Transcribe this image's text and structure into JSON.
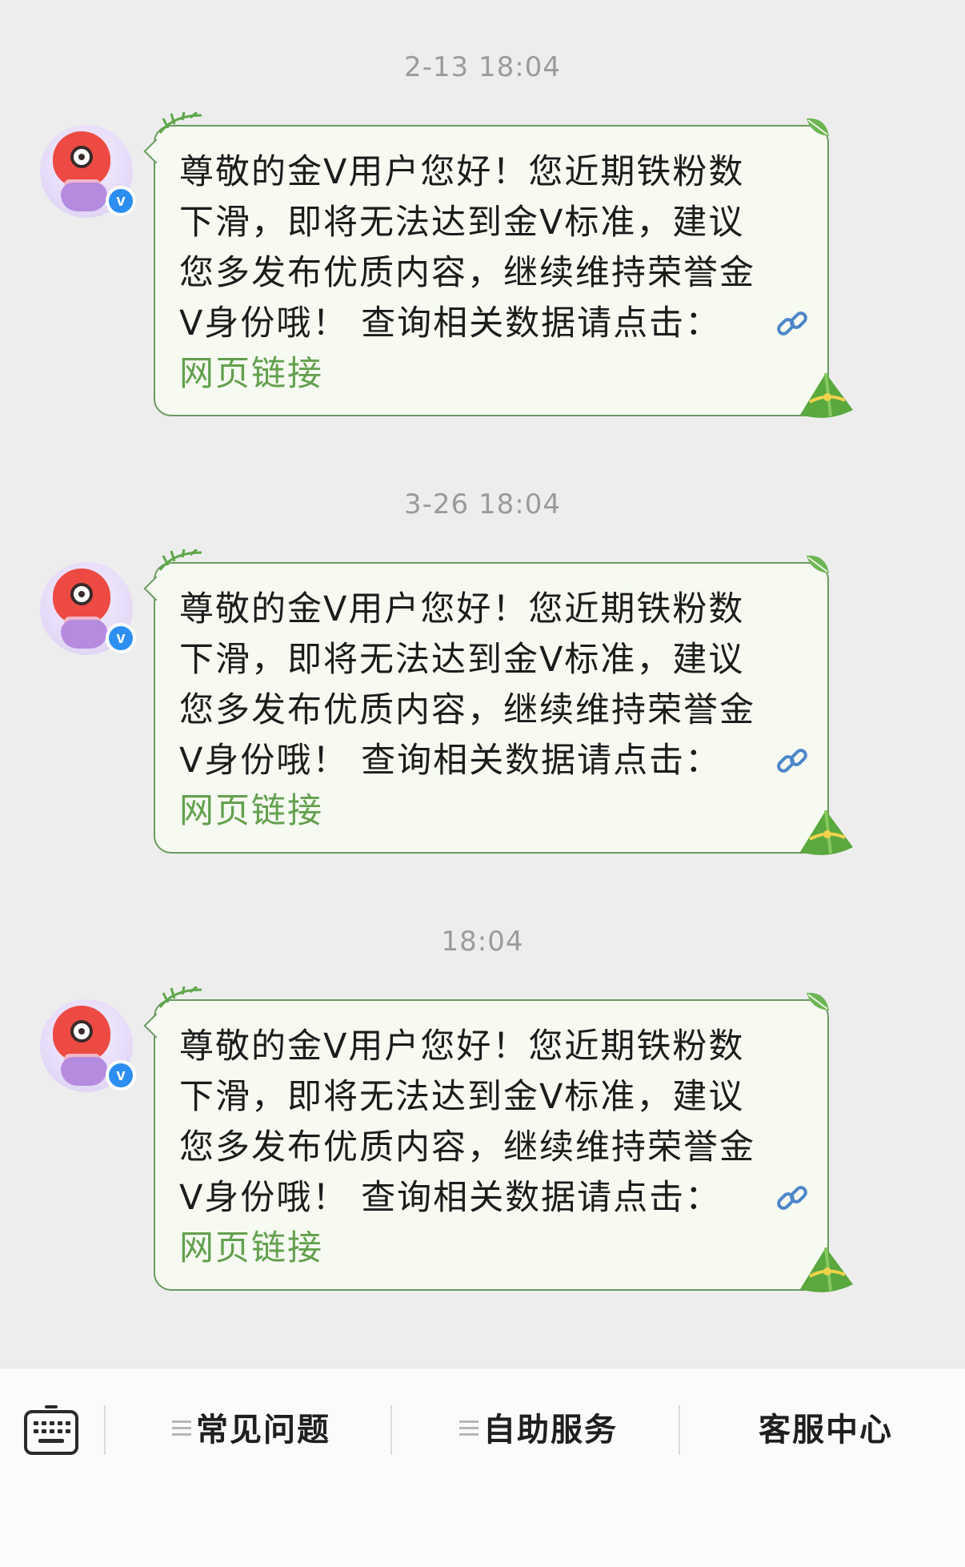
{
  "messages": [
    {
      "timestamp": "2-13 18:04",
      "lines": [
        "尊敬的金V用户您好！您近期铁粉数",
        "下滑，即将无法达到金V标准，建议",
        "您多发布优质内容，继续维持荣誉金",
        "V身份哦！ 查询相关数据请点击："
      ],
      "link_text": "网页链接",
      "verified_mark": "v"
    },
    {
      "timestamp": "3-26 18:04",
      "lines": [
        "尊敬的金V用户您好！您近期铁粉数",
        "下滑，即将无法达到金V标准，建议",
        "您多发布优质内容，继续维持荣誉金",
        "V身份哦！ 查询相关数据请点击："
      ],
      "link_text": "网页链接",
      "verified_mark": "v"
    },
    {
      "timestamp": "18:04",
      "lines": [
        "尊敬的金V用户您好！您近期铁粉数",
        "下滑，即将无法达到金V标准，建议",
        "您多发布优质内容，继续维持荣誉金",
        "V身份哦！ 查询相关数据请点击："
      ],
      "link_text": "网页链接",
      "verified_mark": "v"
    }
  ],
  "bottom_menu": {
    "keyboard_icon": "keyboard-icon",
    "items": [
      "常见问题",
      "自助服务",
      "客服中心"
    ]
  },
  "colors": {
    "background": "#ededed",
    "bubble_bg": "#f6faf1",
    "bubble_border": "#6b9a63",
    "link_green": "#63a04e",
    "verified_blue": "#2b8ef0"
  }
}
